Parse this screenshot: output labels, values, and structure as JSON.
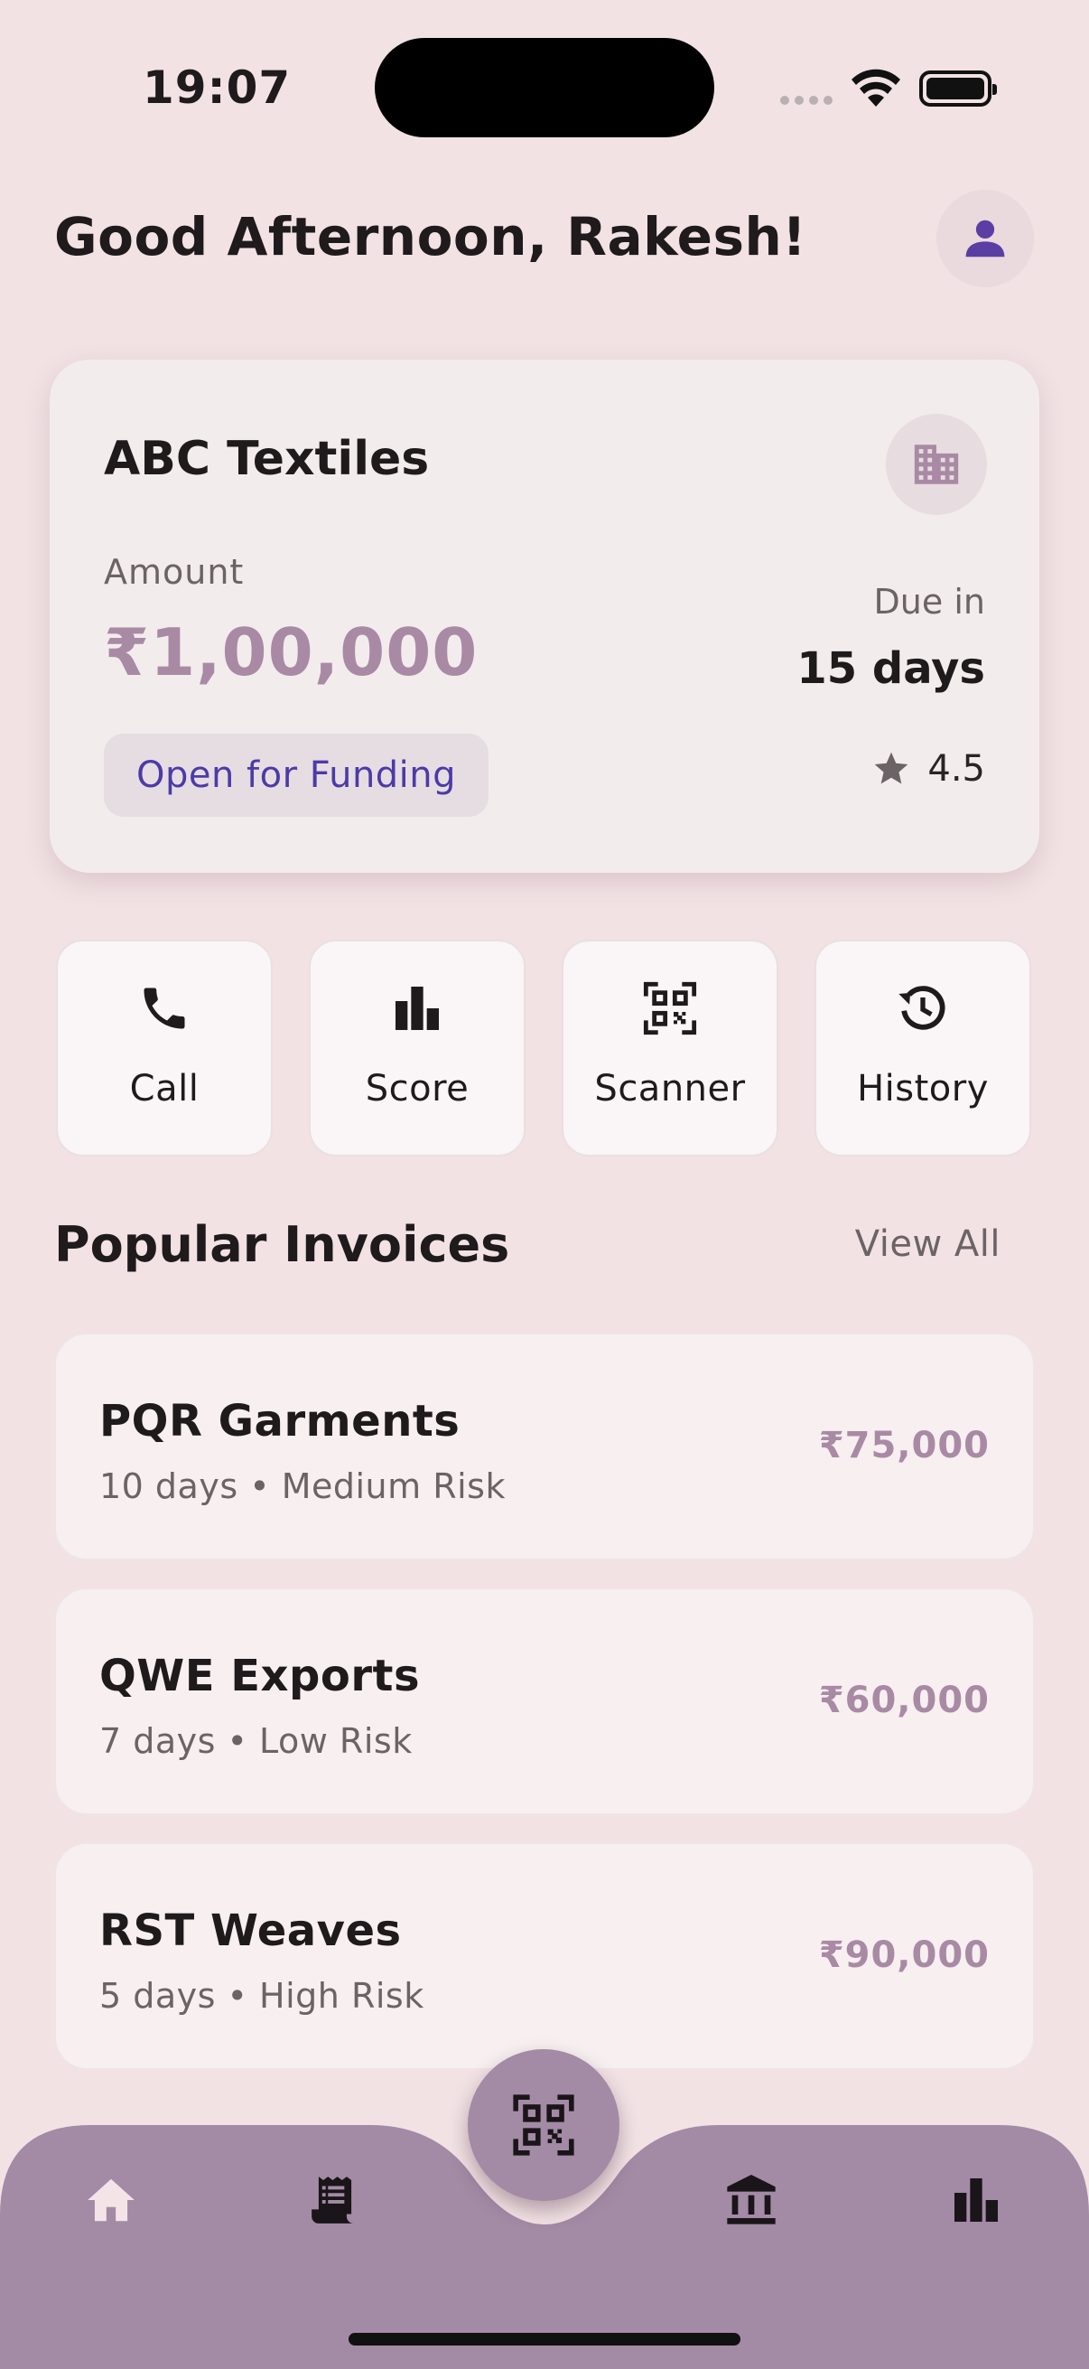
{
  "status_bar": {
    "time": "19:07"
  },
  "header": {
    "greeting": "Good Afternoon, Rakesh!"
  },
  "featured_invoice": {
    "company": "ABC Textiles",
    "amount_label": "Amount",
    "amount": "₹1,00,000",
    "due_label": "Due in",
    "due_value": "15 days",
    "status": "Open for Funding",
    "rating": "4.5"
  },
  "quick_actions": [
    {
      "label": "Call",
      "icon": "phone-icon"
    },
    {
      "label": "Score",
      "icon": "bar-chart-icon"
    },
    {
      "label": "Scanner",
      "icon": "qr-scanner-icon"
    },
    {
      "label": "History",
      "icon": "history-icon"
    }
  ],
  "popular": {
    "title": "Popular Invoices",
    "view_all": "View All",
    "items": [
      {
        "name": "PQR Garments",
        "meta": "10 days • Medium Risk",
        "amount": "₹75,000"
      },
      {
        "name": "QWE Exports",
        "meta": "7 days • Low Risk",
        "amount": "₹60,000"
      },
      {
        "name": "RST Weaves",
        "meta": "5 days • High Risk",
        "amount": "₹90,000"
      }
    ]
  },
  "bottom_nav": {
    "items": [
      "home-icon",
      "receipt-icon",
      "qr-scanner-icon",
      "bank-icon",
      "bar-chart-icon"
    ]
  },
  "colors": {
    "background": "#f2e2e4",
    "accent": "#a98aa4",
    "nav_bar": "#a38aa5",
    "status_chip_text": "#4d3aa8",
    "avatar_icon": "#5b3ea3"
  }
}
